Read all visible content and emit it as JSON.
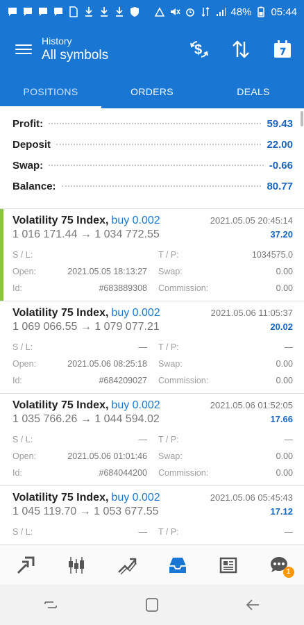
{
  "status_bar": {
    "battery": "48%",
    "time": "05:44",
    "left_icons": [
      "chat-icon",
      "chat-icon",
      "chat-icon",
      "chat-icon",
      "file-icon",
      "download-icon",
      "download-icon",
      "download-icon",
      "shield-icon"
    ],
    "right_icons": [
      "hotspot-icon",
      "mute-icon",
      "alarm-icon",
      "data-icon",
      "signal-icon",
      "battery-icon"
    ]
  },
  "header": {
    "subtitle": "History",
    "title": "All symbols",
    "actions": [
      "dollar-refresh-icon",
      "sort-icon",
      "calendar-icon"
    ]
  },
  "tabs": [
    {
      "label": "POSITIONS",
      "active": true
    },
    {
      "label": "ORDERS",
      "active": false
    },
    {
      "label": "DEALS",
      "active": false
    }
  ],
  "summary": {
    "rows": [
      {
        "label": "Profit:",
        "value": "59.43"
      },
      {
        "label": "Deposit",
        "value": "22.00"
      },
      {
        "label": "Swap:",
        "value": "-0.66"
      },
      {
        "label": "Balance:",
        "value": "80.77"
      }
    ]
  },
  "positions": [
    {
      "symbol": "Volatility 75 Index,",
      "side": "buy 0.002",
      "time": "2021.05.05 20:45:14",
      "prices": "1 016 171.44 → 1 034 772.55",
      "profit": "37.20",
      "sl_label": "S / L:",
      "sl": "",
      "tp_label": "T / P:",
      "tp": "1034575.0",
      "open_label": "Open:",
      "open": "2021.05.05 18:13:27",
      "swap_label": "Swap:",
      "swap": "0.00",
      "id_label": "Id:",
      "id": "#683889308",
      "commission_label": "Commission:",
      "commission": "0.00"
    },
    {
      "symbol": "Volatility 75 Index,",
      "side": "buy 0.002",
      "time": "2021.05.06 11:05:37",
      "prices": "1 069 066.55 → 1 079 077.21",
      "profit": "20.02",
      "sl_label": "S / L:",
      "sl": "—",
      "tp_label": "T / P:",
      "tp": "—",
      "open_label": "Open:",
      "open": "2021.05.06 08:25:18",
      "swap_label": "Swap:",
      "swap": "0.00",
      "id_label": "Id:",
      "id": "#684209027",
      "commission_label": "Commission:",
      "commission": "0.00"
    },
    {
      "symbol": "Volatility 75 Index,",
      "side": "buy 0.002",
      "time": "2021.05.06 01:52:05",
      "prices": "1 035 766.26 → 1 044 594.02",
      "profit": "17.66",
      "sl_label": "S / L:",
      "sl": "—",
      "tp_label": "T / P:",
      "tp": "—",
      "open_label": "Open:",
      "open": "2021.05.06 01:01:46",
      "swap_label": "Swap:",
      "swap": "0.00",
      "id_label": "Id:",
      "id": "#684044200",
      "commission_label": "Commission:",
      "commission": "0.00"
    },
    {
      "symbol": "Volatility 75 Index,",
      "side": "buy 0.002",
      "time": "2021.05.06 05:45:43",
      "prices": "1 045 119.70 → 1 053 677.55",
      "profit": "17.12",
      "sl_label": "S / L:",
      "sl": "—",
      "tp_label": "T / P:",
      "tp": "—"
    }
  ],
  "bottom_nav": {
    "items": [
      "quotes-icon",
      "chart-icon",
      "trade-icon",
      "history-icon",
      "news-icon",
      "messages-icon"
    ],
    "active": "history-icon",
    "messages_badge": "1"
  },
  "system_nav": [
    "recents-icon",
    "home-icon",
    "back-icon"
  ],
  "colors": {
    "primary": "#1976d2",
    "accent_profit": "#1565c0",
    "highlight": "#8bc34a",
    "badge": "#ff9800"
  }
}
